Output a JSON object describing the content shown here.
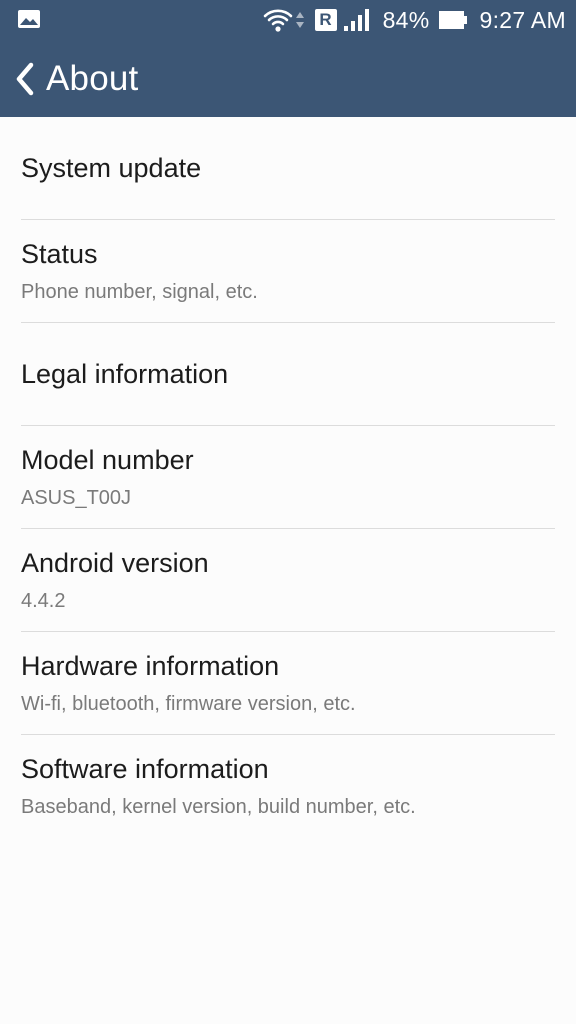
{
  "status_bar": {
    "battery_percent": "84%",
    "time": "9:27 AM",
    "roaming_badge": "R",
    "icons": [
      "gallery-icon",
      "wifi-icon",
      "data-activity-icon",
      "roaming-icon",
      "signal-icon",
      "battery-icon"
    ]
  },
  "action_bar": {
    "title": "About",
    "back_icon": "chevron-left-icon"
  },
  "items": [
    {
      "title": "System update",
      "summary": ""
    },
    {
      "title": "Status",
      "summary": "Phone number, signal, etc."
    },
    {
      "title": "Legal information",
      "summary": ""
    },
    {
      "title": "Model number",
      "summary": "ASUS_T00J"
    },
    {
      "title": "Android version",
      "summary": "4.4.2"
    },
    {
      "title": "Hardware information",
      "summary": "Wi-fi, bluetooth, firmware version, etc."
    },
    {
      "title": "Software information",
      "summary": "Baseband, kernel version, build number, etc."
    }
  ],
  "colors": {
    "bar": "#3c5675",
    "background": "#fcfcfc",
    "title_text": "#1c1c1c",
    "summary_text": "#7a7a7a",
    "divider": "#dcdcdc"
  }
}
